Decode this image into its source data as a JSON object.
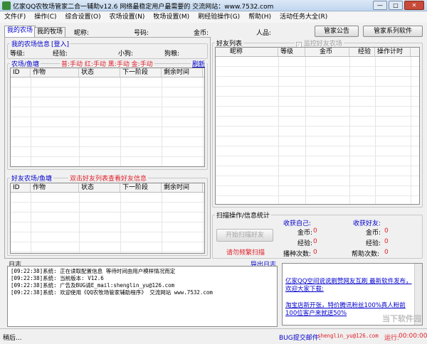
{
  "window": {
    "title": "亿家QQ农牧场管家二合一辅助v12.6   网络最稳定用户最需要的  交流网站：www.7532.com",
    "minimize": "—",
    "maximize": "□",
    "close": "✕"
  },
  "menu": [
    "文件(F)",
    "操作(C)",
    "综合设置(O)",
    "农场设置(N)",
    "牧场设置(M)",
    "刷经验操作(G)",
    "帮助(H)",
    "活动任务大全(R)"
  ],
  "tabs": [
    "我的农场",
    "我的牧场"
  ],
  "info_bar": {
    "nickname": "昵称:",
    "qq": "号码:",
    "gold": "金币:",
    "popularity": "人品:",
    "notice_button": "管家公告",
    "software_button": "管家系列软件"
  },
  "my_farm": {
    "title": "我的农场信息",
    "login": "[登入]",
    "level": "等级:",
    "exp": "经验:",
    "dog": "小狗:",
    "dog_food": "狗粮:"
  },
  "farm_section": {
    "title": "农场/鱼塘",
    "modes": "普:手动  红:手动  黑:手动  金:手动",
    "refresh": "刷新",
    "columns": [
      "ID",
      "作物",
      "状态",
      "下一阶段",
      "剩余时间"
    ]
  },
  "friend_farm": {
    "title": "好友农场/鱼塘",
    "hint": "双击好友列表查看好友信息",
    "columns": [
      "ID",
      "作物",
      "状态",
      "下一阶段",
      "剩余时间"
    ]
  },
  "friends": {
    "title": "好友列表",
    "monitor_label": "监控好友农场",
    "columns": [
      "昵称",
      "等级",
      "金币",
      "经验",
      "操作计时"
    ]
  },
  "scan": {
    "title": "扫描操作/信息统计",
    "start_button": "开始扫描好友",
    "warning": "请勿频繁扫描",
    "self_title": "收获自己:",
    "friend_title": "收获好友:",
    "self_gold_label": "金币:",
    "self_gold": "0",
    "self_exp_label": "经验:",
    "self_exp": "0",
    "plant_count_label": "播种次数:",
    "plant_count": "0",
    "friend_gold_label": "金币:",
    "friend_gold": "0",
    "friend_exp_label": "经验:",
    "friend_exp": "0",
    "help_count_label": "帮助次数:",
    "help_count": "0"
  },
  "log": {
    "title": "日志",
    "export": "导出日志",
    "lines": [
      "[09:22:38]系统: 正在读取配置信息 等待时间由用户模样情况而定",
      "[09:22:38]系统: 当前版本: V12.6",
      "[09:22:38]系统: 广告及BUG请E_mail:shenglin_yu@126.com",
      "[09:22:38]系统: 欢迎使用《QQ农牧场管家辅助程序》 交流网站 www.7532.com"
    ]
  },
  "ads": [
    "亿家QQ空间说说刷赞网友互刷 最新软件发布，欢迎大家下载:",
    "淘宝店新开张，特价腾讯粉丝100%真人粉前100位客户来就送50%"
  ],
  "status": {
    "text": "稍后...",
    "bug_label": "BUG提交邮件:",
    "email": "shenglin_yu@126.com",
    "running_label": "运行:",
    "running_time": "00:00:00"
  },
  "watermark": "当下软件园"
}
